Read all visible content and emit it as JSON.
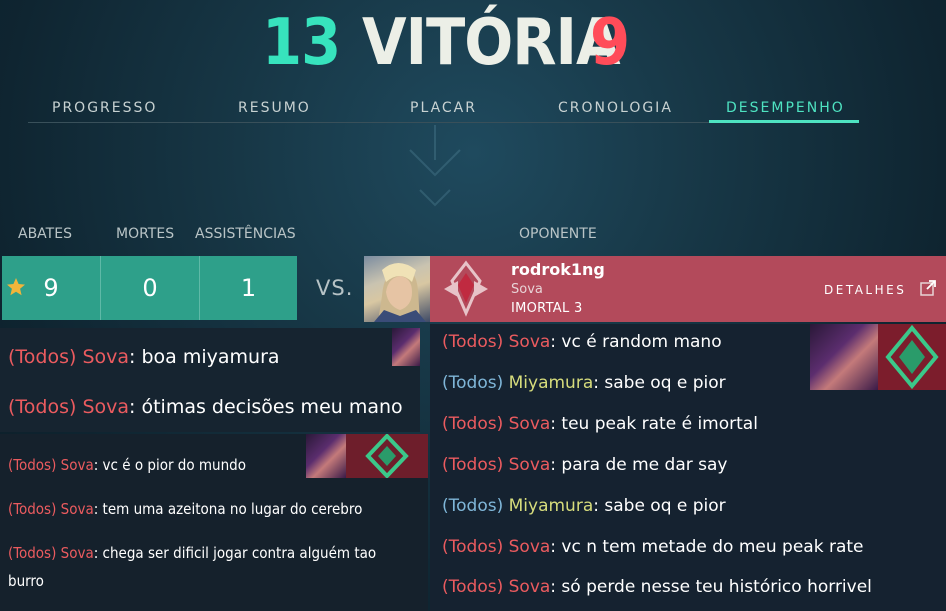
{
  "header": {
    "score_ally": "13",
    "result": "VITÓRIA",
    "score_enemy": "9",
    "colors": {
      "ally": "#37e3bd",
      "enemy": "#ff4c59",
      "accent": "#4ee3c1"
    }
  },
  "tabs": [
    {
      "label": "PROGRESSO"
    },
    {
      "label": "RESUMO"
    },
    {
      "label": "PLACAR"
    },
    {
      "label": "CRONOLOGIA"
    },
    {
      "label": "DESEMPENHO",
      "active": true
    }
  ],
  "stats": {
    "headers": {
      "kills": "ABATES",
      "deaths": "MORTES",
      "assists": "ASSISTÊNCIAS",
      "opponent": "OPONENTE"
    },
    "kills": "9",
    "deaths": "0",
    "assists": "1",
    "vs": "VS."
  },
  "opponent": {
    "name": "rodrok1ng",
    "agent": "Sova",
    "rank": "IMORTAL 3",
    "details_label": "DETALHES"
  },
  "chat_top_left": [
    {
      "channel": "(Todos)",
      "sender": "Sova",
      "text": ": boa miyamura"
    },
    {
      "channel": "(Todos)",
      "sender": "Sova",
      "text": ": ótimas decisões meu mano"
    }
  ],
  "chat_bottom_left": [
    {
      "channel": "(Todos)",
      "sender": "Sova",
      "text": ": vc é o pior do mundo"
    },
    {
      "channel": "(Todos)",
      "sender": "Sova",
      "text": ": tem uma azeitona no lugar do cerebro"
    },
    {
      "channel": "(Todos)",
      "sender": "Sova",
      "text": ": chega ser dificil jogar contra alguém tao"
    },
    {
      "text": "burro"
    }
  ],
  "chat_right": [
    {
      "channel": "(Todos)",
      "sender": "Sova",
      "text": ": vc é random mano",
      "team": "enemy"
    },
    {
      "channel": "(Todos)",
      "sender": "Miyamura",
      "text": ": sabe oq e pior",
      "team": "ally"
    },
    {
      "channel": "(Todos)",
      "sender": "Sova",
      "text": ": teu peak rate é imortal",
      "team": "enemy"
    },
    {
      "channel": "(Todos)",
      "sender": "Sova",
      "text": ": para de me dar say",
      "team": "enemy"
    },
    {
      "channel": "(Todos)",
      "sender": "Miyamura",
      "text": ": sabe oq e pior",
      "team": "ally"
    },
    {
      "channel": "(Todos)",
      "sender": "Sova",
      "text": ": vc n tem metade do meu peak rate",
      "team": "enemy"
    },
    {
      "channel": "(Todos)",
      "sender": "Sova",
      "text": ": só perde nesse teu histórico horrivel",
      "team": "enemy"
    }
  ],
  "icons": [
    "star-icon",
    "rank-emblem-icon",
    "external-link-icon",
    "agent-portrait",
    "reyna-portrait",
    "ascendant-rank-icon"
  ]
}
